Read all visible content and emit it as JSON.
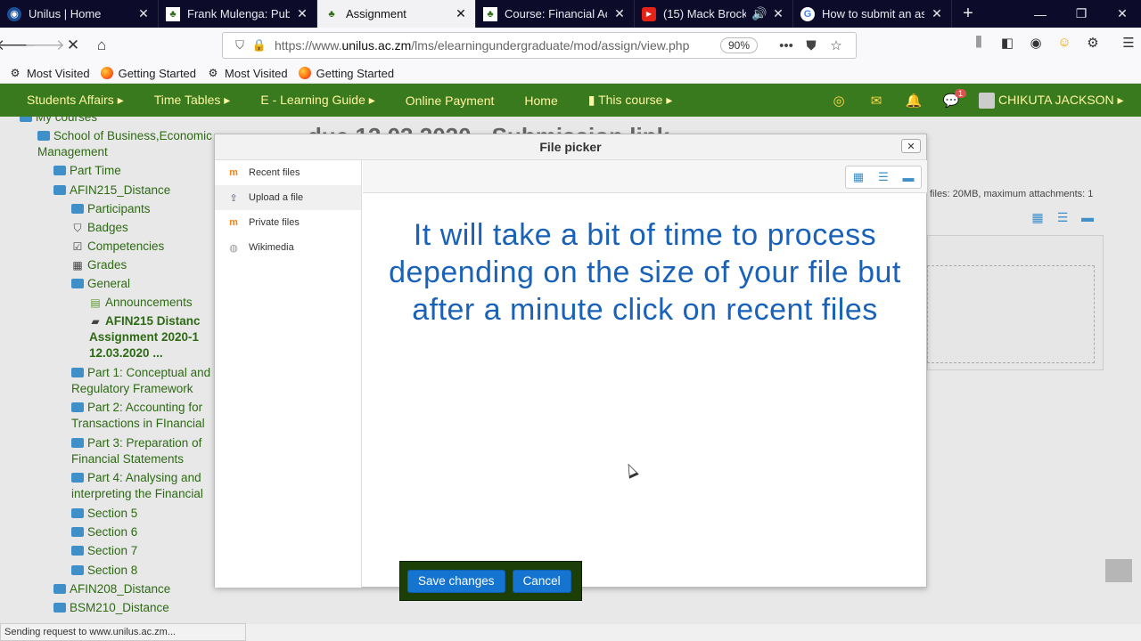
{
  "browser": {
    "tabs": [
      {
        "label": "Unilus | Home",
        "active": false,
        "icon": "unilus-favicon"
      },
      {
        "label": "Frank Mulenga: Public",
        "active": false,
        "icon": "unilus-favicon"
      },
      {
        "label": "Assignment",
        "active": true,
        "icon": "unilus-favicon"
      },
      {
        "label": "Course: Financial Acco",
        "active": false,
        "icon": "unilus-favicon"
      },
      {
        "label": "(15) Mack Brock -",
        "active": false,
        "icon": "youtube-favicon"
      },
      {
        "label": "How to submit an assi",
        "active": false,
        "icon": "google-favicon"
      }
    ],
    "url_prefix": "https://www.",
    "url_domain": "unilus.ac.zm",
    "url_path": "/lms/elearningundergraduate/mod/assign/view.php",
    "zoom": "90%",
    "bookmarks": [
      {
        "label": "Most Visited",
        "icon": "gear-icon"
      },
      {
        "label": "Getting Started",
        "icon": "firefox-icon"
      },
      {
        "label": "Most Visited",
        "icon": "gear-icon"
      },
      {
        "label": "Getting Started",
        "icon": "firefox-icon"
      }
    ],
    "status": "Sending request to www.unilus.ac.zm..."
  },
  "sitenav": {
    "items": [
      "Students Affairs ▸",
      "Time Tables ▸",
      "E - Learning Guide ▸",
      "Online Payment",
      "Home",
      "▮ This course ▸"
    ],
    "user": "CHIKUTA JACKSON ▸",
    "message_badge": "1"
  },
  "sidebar": {
    "my_courses": "My courses",
    "school": "School of Business,Economic",
    "school_2": "Management",
    "part_time": "Part Time",
    "course": "AFIN215_Distance",
    "participants": "Participants",
    "badges": "Badges",
    "competencies": "Competencies",
    "grades": "Grades",
    "general": "General",
    "announcements": "Announcements",
    "assignment_1": "AFIN215 Distanc",
    "assignment_2": "Assignment 2020-1",
    "assignment_3": "12.03.2020 ...",
    "part1_a": "Part 1: Conceptual and",
    "part1_b": "Regulatory Framework",
    "part2_a": "Part 2: Accounting for",
    "part2_b": "Transactions in FInancial",
    "part3_a": "Part 3: Preparation of",
    "part3_b": "Financial Statements",
    "part4_a": "Part 4: Analysing and",
    "part4_b": "interpreting the Financial",
    "section5": "Section 5",
    "section6": "Section 6",
    "section7": "Section 7",
    "section8": "Section 8",
    "afin208": "AFIN208_Distance",
    "bsm210": "BSM210_Distance"
  },
  "background": {
    "title": "due 12.03.2020 - Submission link",
    "note": "files: 20MB, maximum attachments: 1"
  },
  "file_picker": {
    "title": "File picker",
    "close": "✕",
    "repositories": [
      {
        "label": "Recent files",
        "icon": "moodle-icon"
      },
      {
        "label": "Upload a file",
        "icon": "upload-icon"
      },
      {
        "label": "Private files",
        "icon": "moodle-icon"
      },
      {
        "label": "Wikimedia",
        "icon": "wikimedia-icon"
      }
    ],
    "overlay_text": "It will take a bit of time to process depending on the size of your file but after a minute click on recent files",
    "save_label": "Save changes",
    "cancel_label": "Cancel"
  }
}
